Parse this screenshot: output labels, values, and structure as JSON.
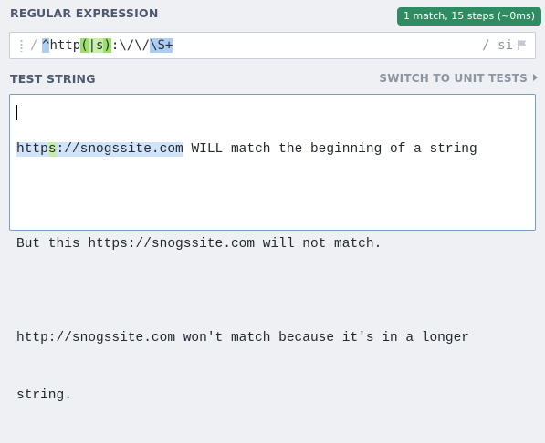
{
  "regex_section": {
    "title": "REGULAR EXPRESSION",
    "match_info": "1 match, 15 steps (~0ms)",
    "delimiter_open": "/",
    "pattern_tokens": [
      {
        "text": "^",
        "kind": "anchor"
      },
      {
        "text": "http",
        "kind": "plain"
      },
      {
        "text": "(",
        "kind": "group"
      },
      {
        "text": "|",
        "kind": "alt"
      },
      {
        "text": "s",
        "kind": "alt"
      },
      {
        "text": ")",
        "kind": "group"
      },
      {
        "text": ":",
        "kind": "plain"
      },
      {
        "text": "\\/\\/",
        "kind": "escape"
      },
      {
        "text": "\\S+",
        "kind": "class"
      }
    ],
    "flags": "/ si",
    "flags_icon": "flag-icon"
  },
  "test_section": {
    "title": "TEST STRING",
    "switch_label": "SWITCH TO UNIT TESTS",
    "switch_icon": "arrow-right-icon",
    "line1": {
      "m1": "http",
      "g": "s",
      "m2": "://snogssite.com",
      "rest": " WILL match the beginning of a string"
    },
    "lines": [
      "",
      "But this https://snogssite.com will not match.",
      "",
      "http://snogssite.com won't match because it's in a longer",
      "string."
    ]
  },
  "colors": {
    "match_badge": "#2e8b62",
    "match_highlight": "#d1e3f8",
    "group_highlight": "#c6ecac"
  }
}
